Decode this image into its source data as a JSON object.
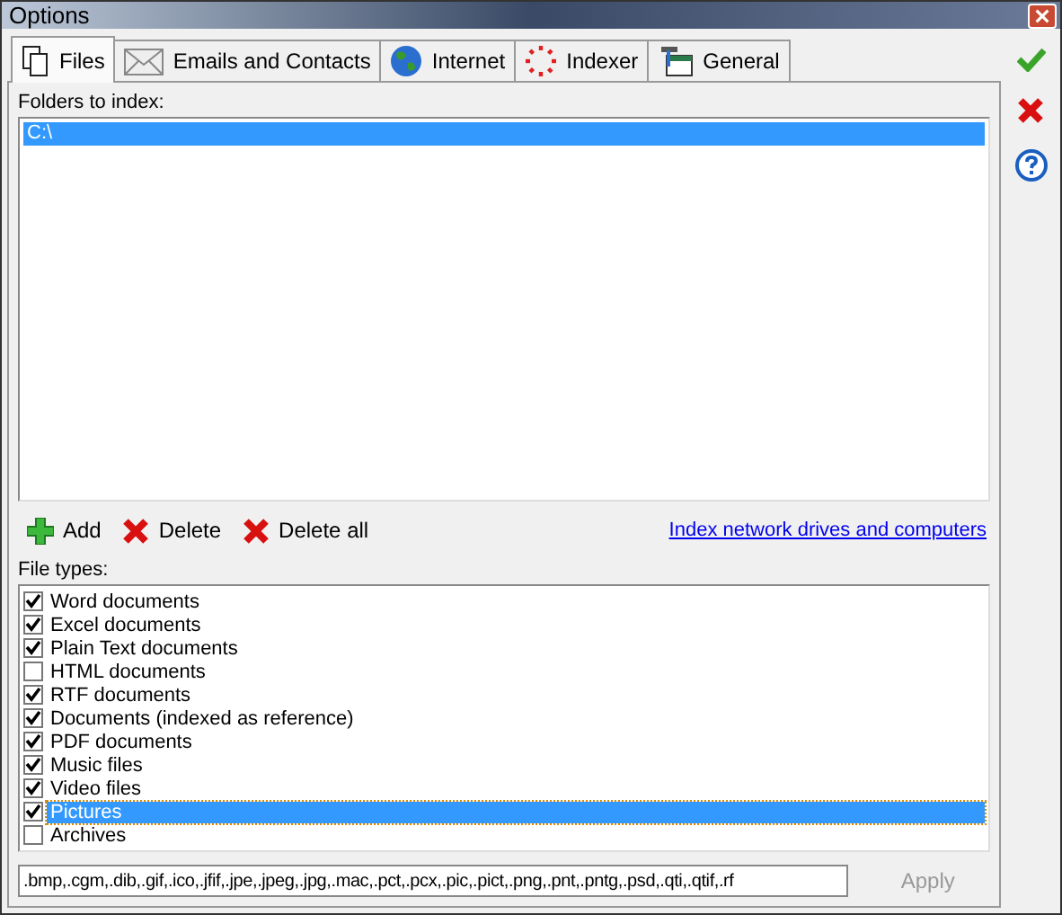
{
  "window": {
    "title": "Options"
  },
  "tabs": [
    {
      "label": "Files",
      "kind": "pages",
      "selected": true
    },
    {
      "label": "Emails and Contacts",
      "kind": "envelope",
      "selected": false
    },
    {
      "label": "Internet",
      "kind": "globe",
      "selected": false
    },
    {
      "label": "Indexer",
      "kind": "burst",
      "selected": false
    },
    {
      "label": "General",
      "kind": "tools",
      "selected": false
    }
  ],
  "folders": {
    "label": "Folders to index:",
    "items": [
      {
        "text": "C:\\",
        "selected": true
      }
    ]
  },
  "toolbar": [
    {
      "label": "Add",
      "kind": "add"
    },
    {
      "label": "Delete",
      "kind": "delete"
    },
    {
      "label": "Delete all",
      "kind": "delete"
    }
  ],
  "network_link": "Index network drives and computers",
  "file_types": {
    "label": "File types:",
    "items": [
      {
        "text": "Word documents",
        "checked": true,
        "selected": false
      },
      {
        "text": "Excel documents",
        "checked": true,
        "selected": false
      },
      {
        "text": "Plain Text documents",
        "checked": true,
        "selected": false
      },
      {
        "text": "HTML documents",
        "checked": false,
        "selected": false
      },
      {
        "text": "RTF documents",
        "checked": true,
        "selected": false
      },
      {
        "text": "Documents (indexed as reference)",
        "checked": true,
        "selected": false
      },
      {
        "text": "PDF documents",
        "checked": true,
        "selected": false
      },
      {
        "text": "Music files",
        "checked": true,
        "selected": false
      },
      {
        "text": "Video files",
        "checked": true,
        "selected": false
      },
      {
        "text": "Pictures",
        "checked": true,
        "selected": true
      },
      {
        "text": "Archives",
        "checked": false,
        "selected": false
      }
    ]
  },
  "extensions": {
    "value": ".bmp,.cgm,.dib,.gif,.ico,.jfif,.jpe,.jpeg,.jpg,.mac,.pct,.pcx,.pic,.pict,.png,.pnt,.pntg,.psd,.qti,.qtif,.rf"
  },
  "apply": {
    "label": "Apply",
    "disabled": true
  }
}
